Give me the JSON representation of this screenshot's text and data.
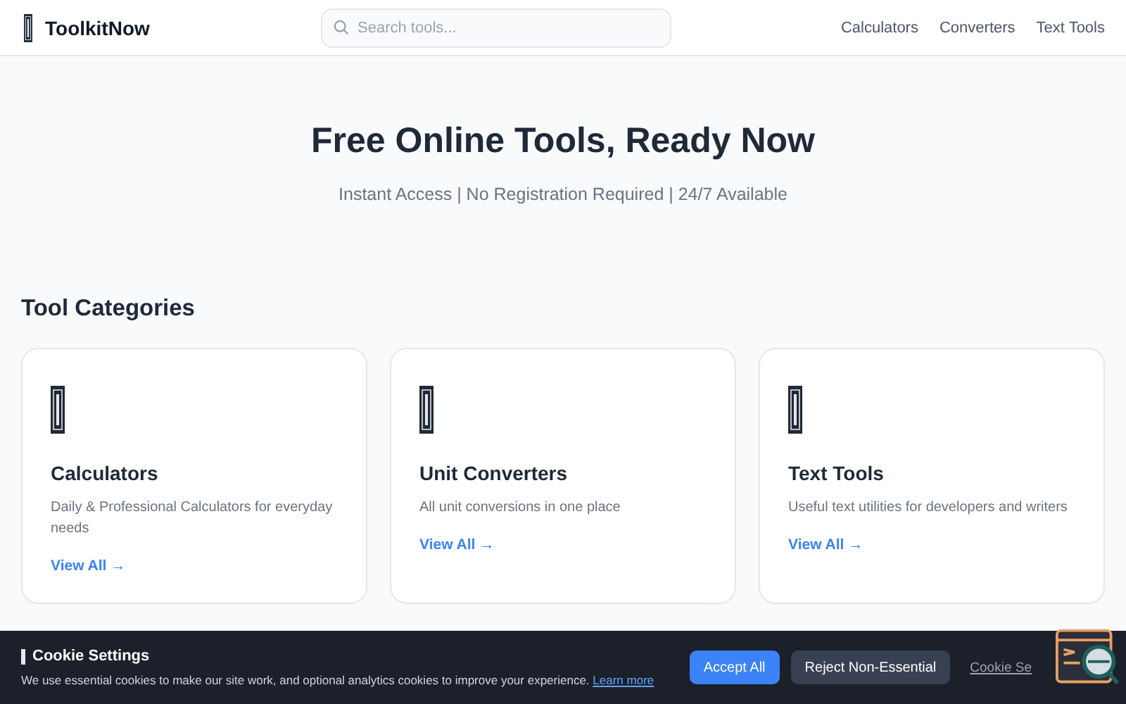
{
  "header": {
    "brand": "ToolkitNow",
    "search": {
      "placeholder": "Search tools..."
    },
    "nav": [
      "Calculators",
      "Converters",
      "Text Tools"
    ]
  },
  "hero": {
    "title": "Free Online Tools, Ready Now",
    "subtitle": "Instant Access | No Registration Required | 24/7 Available"
  },
  "categories": {
    "heading": "Tool Categories",
    "cards": [
      {
        "title": "Calculators",
        "description": "Daily & Professional Calculators for everyday needs",
        "link": "View All →"
      },
      {
        "title": "Unit Converters",
        "description": "All unit conversions in one place",
        "link": "View All →"
      },
      {
        "title": "Text Tools",
        "description": "Useful text utilities for developers and writers",
        "link": "View All →"
      }
    ]
  },
  "cookie_banner": {
    "title": "Cookie Settings",
    "message": "We use essential cookies to make our site work, and optional analytics cookies to improve your experience.",
    "learn_more": "Learn more",
    "buttons": [
      "Accept All",
      "Reject Non-Essential"
    ],
    "settings_link": "Cookie Se"
  }
}
